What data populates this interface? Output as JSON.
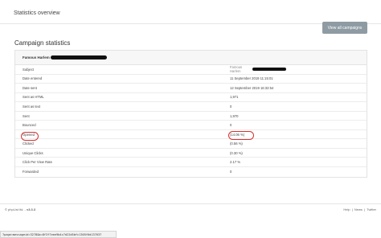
{
  "header": {
    "title": "Statistics overview"
  },
  "section": {
    "title": "Campaign statistics"
  },
  "actions": {
    "view_all_label": "View all campaigns"
  },
  "table": {
    "heading": "Famous Harlem",
    "rows": [
      {
        "label": "Subject",
        "value": "Famous Harlem",
        "muted": true
      },
      {
        "label": "Date entered",
        "value": "11 September 2019 11:15:01",
        "muted": false
      },
      {
        "label": "Date sent",
        "value": "12 September 2019 16:32:54",
        "muted": false
      },
      {
        "label": "Sent as HTML",
        "value": "1,971",
        "muted": false
      },
      {
        "label": "Sent as text",
        "value": "0",
        "muted": false
      },
      {
        "label": "Sent",
        "value": "1,970",
        "muted": false
      },
      {
        "label": "Bounced",
        "value": "0",
        "muted": false
      },
      {
        "label": "Opened",
        "value": "(14.06 %)",
        "muted": false
      },
      {
        "label": "Clicked",
        "value": "(0.56 %)",
        "muted": false
      },
      {
        "label": "Unique Clicks",
        "value": "(0.30 %)",
        "muted": false
      },
      {
        "label": "Click Per View Rate",
        "value": "2.17 %",
        "muted": false
      },
      {
        "label": "Forwarded",
        "value": "0",
        "muted": false
      }
    ]
  },
  "footer": {
    "copyright": "© phpList ltd. -",
    "version": "v3.3.3",
    "links": [
      "Help",
      "News",
      "Twitter"
    ],
    "separator": "|"
  },
  "status_bar": {
    "url": "?page=messageid=3278&b=8f3f7eee9b4c7d22d5bfc1305f6d137637"
  },
  "colors": {
    "annotation": "#d93030",
    "button": "#8e9ba3"
  }
}
